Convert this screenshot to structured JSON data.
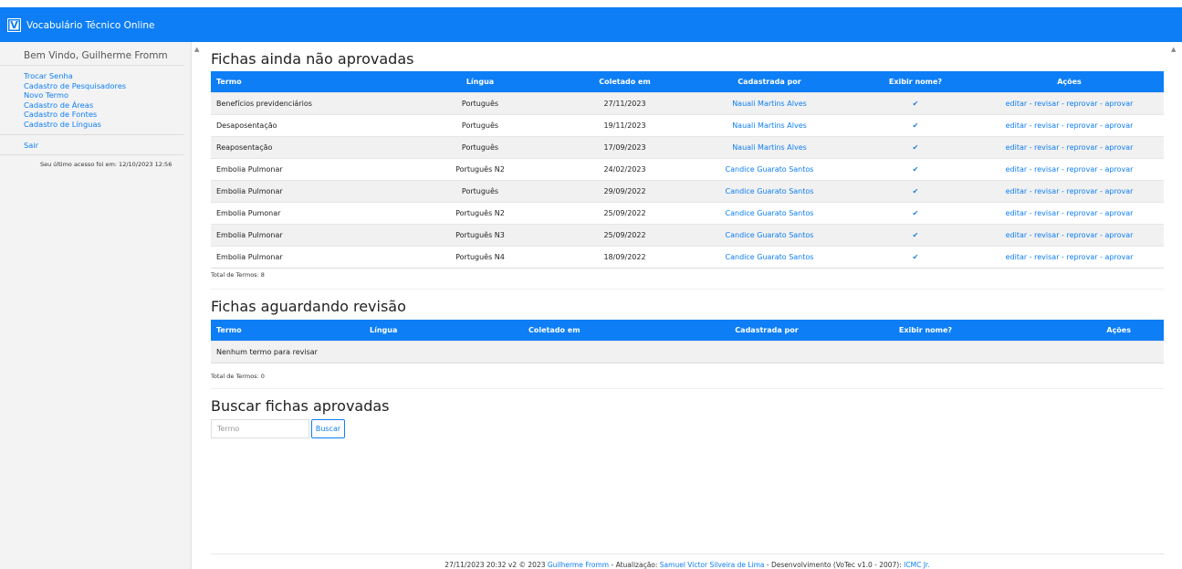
{
  "app": {
    "logo_letter": "V",
    "title": "Vocabulário Técnico Online"
  },
  "sidebar": {
    "welcome": "Bem Vindo, Guilherme Fromm",
    "links": [
      "Trocar Senha",
      "Cadastro de Pesquisadores",
      "Novo Termo",
      "Cadastro de Áreas",
      "Cadastro de Fontes",
      "Cadastro de Línguas"
    ],
    "exit": "Sair",
    "last_access": "Seu último acesso foi em: 12/10/2023 12:56"
  },
  "section1": {
    "title": "Fichas ainda não aprovadas",
    "headers": [
      "Termo",
      "Língua",
      "Coletado em",
      "Cadastrada por",
      "Exibir nome?",
      "Ações"
    ],
    "rows": [
      {
        "termo": "Benefícios previdenciários",
        "lingua": "Português",
        "data": "27/11/2023",
        "por": "Nauali Martins Alves",
        "exibir": "✔",
        "acoes": "editar - revisar - reprovar - aprovar"
      },
      {
        "termo": "Desaposentação",
        "lingua": "Português",
        "data": "19/11/2023",
        "por": "Nauali Martins Alves",
        "exibir": "✔",
        "acoes": "editar - revisar - reprovar - aprovar"
      },
      {
        "termo": "Reaposentação",
        "lingua": "Português",
        "data": "17/09/2023",
        "por": "Nauali Martins Alves",
        "exibir": "✔",
        "acoes": "editar - revisar - reprovar - aprovar"
      },
      {
        "termo": "Embolia Pulmonar",
        "lingua": "Português N2",
        "data": "24/02/2023",
        "por": "Candice Guarato Santos",
        "exibir": "✔",
        "acoes": "editar - revisar - reprovar - aprovar"
      },
      {
        "termo": "Embolia Pulmonar",
        "lingua": "Português",
        "data": "29/09/2022",
        "por": "Candice Guarato Santos",
        "exibir": "✔",
        "acoes": "editar - revisar - reprovar - aprovar"
      },
      {
        "termo": "Embolia Pumonar",
        "lingua": "Português N2",
        "data": "25/09/2022",
        "por": "Candice Guarato Santos",
        "exibir": "✔",
        "acoes": "editar - revisar - reprovar - aprovar"
      },
      {
        "termo": "Embolia Pulmonar",
        "lingua": "Português N3",
        "data": "25/09/2022",
        "por": "Candice Guarato Santos",
        "exibir": "✔",
        "acoes": "editar - revisar - reprovar - aprovar"
      },
      {
        "termo": "Embolia Pulmonar",
        "lingua": "Português N4",
        "data": "18/09/2022",
        "por": "Candice Guarato Santos",
        "exibir": "✔",
        "acoes": "editar - revisar - reprovar - aprovar"
      }
    ],
    "total": "Total de Termos: 8"
  },
  "section2": {
    "title": "Fichas aguardando revisão",
    "headers": [
      "Termo",
      "Língua",
      "Coletado em",
      "Cadastrada por",
      "Exibir nome?",
      "Ações"
    ],
    "empty": "Nenhum termo para revisar",
    "total": "Total de Termos: 0"
  },
  "section3": {
    "title": "Buscar fichas aprovadas",
    "placeholder": "Termo",
    "button": "Buscar"
  },
  "footer": {
    "prefix": "27/11/2023 20:32 v2 © 2023 ",
    "author": "Guilherme Fromm",
    "mid1": " - Atualização: ",
    "updater": "Samuel Victor Silveira de Lima",
    "mid2": " - Desenvolvimento (VoTec v1.0 - 2007): ",
    "dev": "ICMC Jr."
  },
  "colors": {
    "primary": "#0d7ef5",
    "sidebar_bg": "#f3f3f3",
    "stripe": "#f1f1f1"
  }
}
